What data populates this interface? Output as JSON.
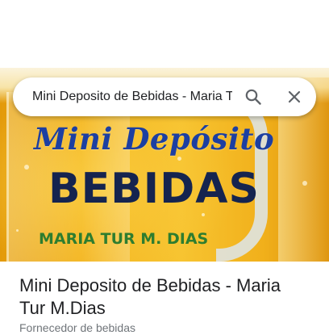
{
  "search": {
    "query": "Mini Deposito de Bebidas - Maria Tur M.Dias",
    "search_icon": "search-icon",
    "close_icon": "close-icon"
  },
  "hero_image": {
    "script_title": "Mini Depósito",
    "main_title": "BEBIDAS",
    "subtitle": "MARIA TUR M. DIAS"
  },
  "place": {
    "name": "Mini Deposito de Bebidas - Maria Tur M.Dias",
    "category": "Fornecedor de bebidas"
  },
  "colors": {
    "script_title": "#1d3fa1",
    "main_title": "#15244f",
    "subtitle": "#2e7d2f",
    "beer_background": "#f2b21d"
  }
}
